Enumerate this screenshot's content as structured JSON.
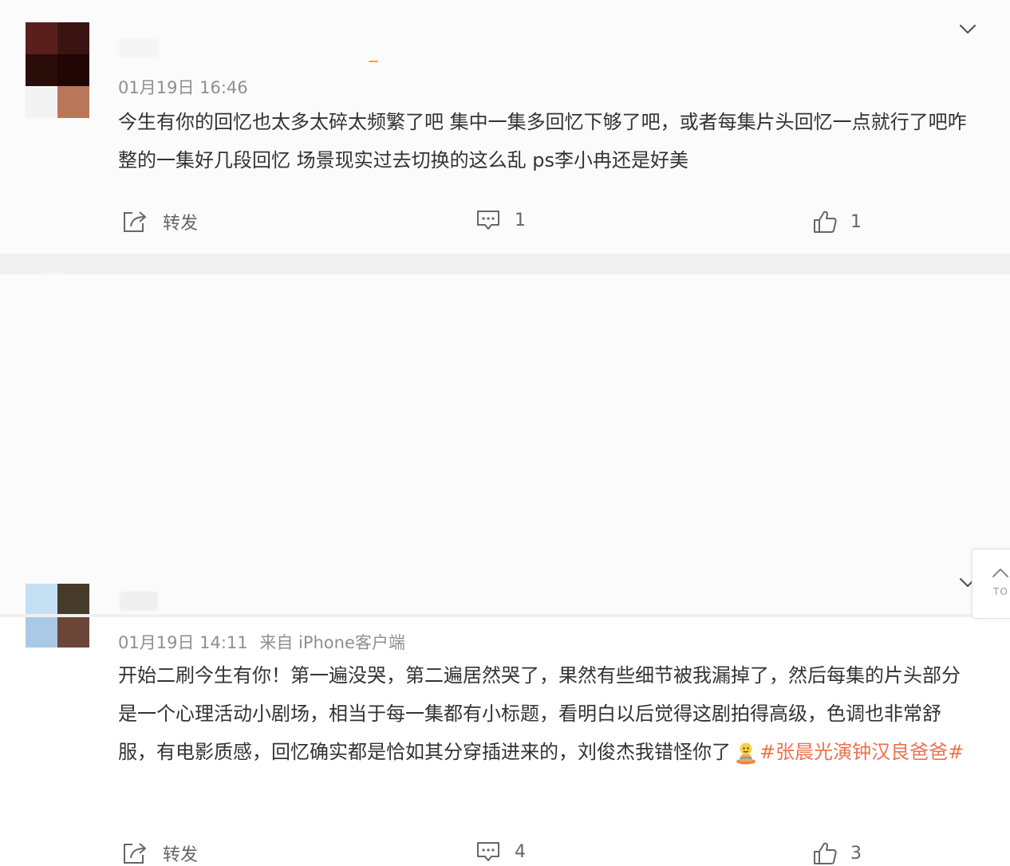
{
  "posts": [
    {
      "timestamp": "01月19日 16:46",
      "source": "",
      "content": "今生有你的回忆也太多太碎太频繁了吧 集中一集多回忆下够了吧，或者每集片头回忆一点就行了吧咋整的一集好几段回忆 场景现实过去切换的这么乱 ps李小冉还是好美",
      "repost_label": "转发",
      "comment_count": "1",
      "like_count": "1"
    },
    {
      "timestamp": "01月19日 14:11",
      "source": "来自 iPhone客户端",
      "content": "开始二刷今生有你！第一遍没哭，第二遍居然哭了，果然有些细节被我漏掉了，然后每集的片头部分是一个心理活动小剧场，相当于每一集都有小标题，看明白以后觉得这剧拍得高级，色调也非常舒服，有电影质感，回忆确实都是恰如其分穿插进来的，刘俊杰我错怪你了",
      "hashtag": "#张晨光演钟汉良爸爸#",
      "repost_label": "转发",
      "comment_count": "4",
      "like_count": "3"
    }
  ],
  "to_top_label": "TO",
  "icons": {
    "expand": "chevron-down-icon",
    "repost": "repost-icon",
    "comment": "comment-icon",
    "like": "thumbs-up-icon",
    "emoji": "emoji-icon",
    "to_top": "arrow-up-icon"
  },
  "colors": {
    "hashtag": "#eb7350",
    "meta": "#8f8f8f",
    "text": "#333333",
    "avatar_1": [
      "#5a1f1d",
      "#3a1410",
      "#2a0c08",
      "#200605",
      "#f3f3f3",
      "#b97759"
    ],
    "avatar_2": [
      "#c5dff4",
      "#463a2b",
      "#a9c9e6",
      "#6b4638"
    ]
  }
}
